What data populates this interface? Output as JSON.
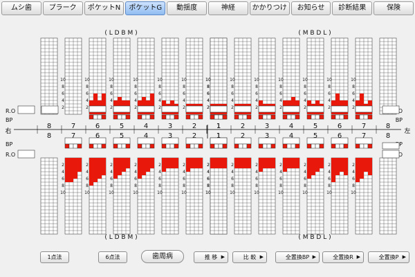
{
  "tabs": [
    {
      "label": "ムシ歯",
      "active": false
    },
    {
      "label": "プラーク",
      "active": false
    },
    {
      "label": "ポケットN",
      "active": false
    },
    {
      "label": "ポケットG",
      "active": true
    },
    {
      "label": "動揺度",
      "active": false
    },
    {
      "label": "神経",
      "active": false
    },
    {
      "label": "かかりつけ",
      "active": false
    },
    {
      "label": "お知らせ",
      "active": false
    },
    {
      "label": "診断結果",
      "active": false
    },
    {
      "label": "保険",
      "active": false
    }
  ],
  "labels": {
    "upper_left_surfaces": "( L D B M )",
    "upper_right_surfaces": "( M B D L )",
    "lower_left_surfaces": "( L D B M )",
    "lower_right_surfaces": "( M B D L )",
    "ro": "R.O",
    "bp": "BP",
    "side_right": "右",
    "side_left": "左"
  },
  "tooth_numbers_left": [
    "8",
    "7",
    "6",
    "5",
    "4",
    "3",
    "2",
    "1"
  ],
  "tooth_numbers_right": [
    "1",
    "2",
    "3",
    "4",
    "5",
    "6",
    "7",
    "8"
  ],
  "scale_labels": [
    "2",
    "4",
    "6",
    "8",
    "10"
  ],
  "colors": {
    "fill": "#e8190a",
    "grid": "#444444",
    "background": "#f0f0f0"
  },
  "chart_data": {
    "type": "heatmap",
    "unit_max": 10,
    "upper_jaw": {
      "teeth": [
        "8",
        "7",
        "6",
        "5",
        "4",
        "3",
        "2",
        "1",
        "1",
        "2",
        "3",
        "4",
        "5",
        "6",
        "7",
        "8"
      ],
      "depths": [
        null,
        null,
        [
          4,
          6,
          4,
          6
        ],
        [
          4,
          5,
          4,
          4
        ],
        [
          4,
          5,
          4,
          6
        ],
        [
          4,
          3,
          4,
          3
        ],
        [
          3,
          3,
          3,
          3
        ],
        [
          3,
          3,
          3,
          3
        ],
        [
          3,
          3,
          3,
          3
        ],
        [
          3,
          3,
          3,
          3
        ],
        [
          4,
          3,
          3,
          3
        ],
        [
          4,
          4,
          5,
          4
        ],
        [
          4,
          3,
          4,
          3
        ],
        [
          4,
          6,
          4,
          4
        ],
        [
          4,
          6,
          3,
          4
        ],
        null
      ]
    },
    "lower_jaw": {
      "teeth": [
        "8",
        "7",
        "6",
        "5",
        "4",
        "3",
        "2",
        "1",
        "1",
        "2",
        "3",
        "4",
        "5",
        "6",
        "7",
        "8"
      ],
      "depths": [
        null,
        [
          7,
          7,
          6,
          4
        ],
        [
          8,
          7,
          6,
          5
        ],
        [
          6,
          5,
          4,
          3
        ],
        [
          6,
          5,
          4,
          3
        ],
        [
          4,
          3,
          3,
          3
        ],
        [
          4,
          3,
          3,
          3
        ],
        [
          4,
          3,
          3,
          4
        ],
        [
          3,
          3,
          3,
          3
        ],
        [
          3,
          3,
          3,
          3
        ],
        [
          4,
          3,
          3,
          3
        ],
        [
          4,
          3,
          3,
          3
        ],
        [
          6,
          5,
          4,
          3
        ],
        [
          7,
          5,
          4,
          5
        ],
        [
          7,
          6,
          4,
          5
        ],
        null
      ]
    }
  },
  "buttons": {
    "one_point": "1点法",
    "six_point": "6点法",
    "periodontal": "歯周病",
    "transfer": "推 移",
    "compare": "比 較",
    "replace_all_bp": "全置換BP",
    "replace_all_r": "全置換R",
    "replace_all_p": "全置換P"
  }
}
